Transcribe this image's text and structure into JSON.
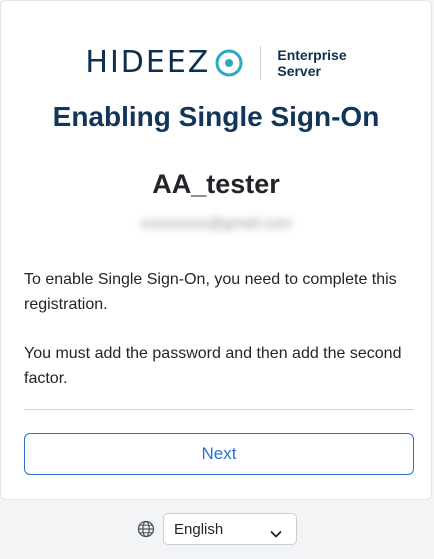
{
  "brand": {
    "wordmark": "HIDEEZ",
    "sub_line1": "Enterprise",
    "sub_line2": "Server",
    "color": "#0f2f4f",
    "accent": "#2aa9c7"
  },
  "page": {
    "title": "Enabling Single Sign-On",
    "username": "AA_tester",
    "email": "xxxxxxxxx@gmail.com",
    "paragraph1": "To enable Single Sign-On, you need to complete this registration.",
    "paragraph2": "You must add the password and then add the second factor."
  },
  "actions": {
    "next_label": "Next"
  },
  "language": {
    "icon": "globe-icon",
    "selected": "English"
  }
}
